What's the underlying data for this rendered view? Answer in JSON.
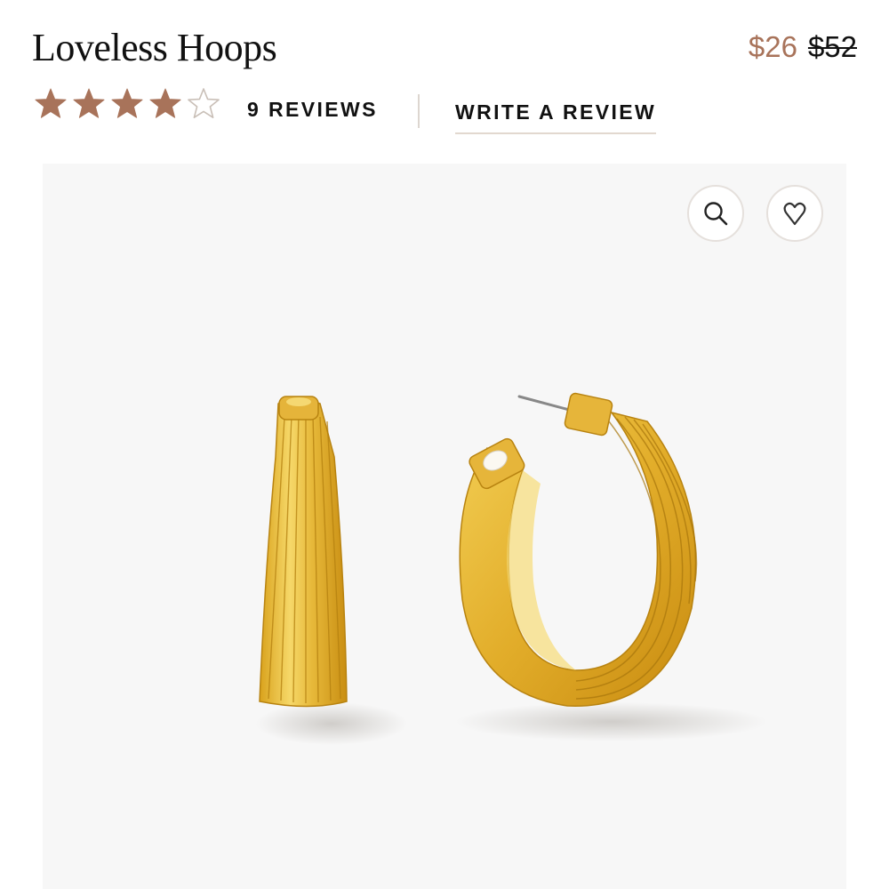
{
  "product": {
    "title": "Loveless Hoops",
    "price_sale": "$26",
    "price_original": "$52"
  },
  "rating": {
    "value": 4,
    "max": 5,
    "reviews_label": "9 REVIEWS",
    "write_review_label": "WRITE A REVIEW"
  },
  "image_actions": {
    "zoom_icon": "search-icon",
    "favorite_icon": "heart-icon"
  },
  "colors": {
    "sale_price": "#a8735a",
    "star_filled": "#a8735a",
    "gold": "#e3b334"
  }
}
